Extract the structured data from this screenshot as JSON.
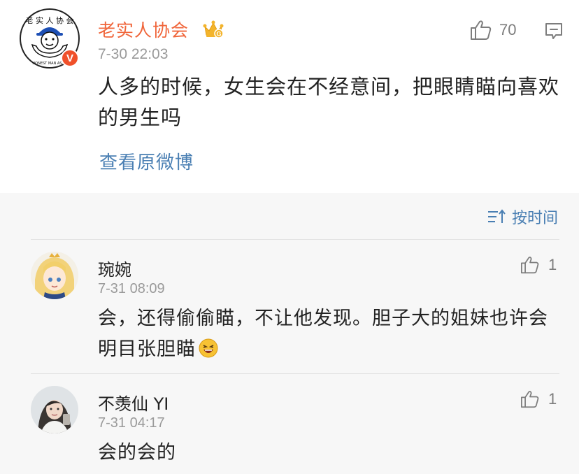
{
  "post": {
    "author": "老实人协会",
    "verified_badge": "V",
    "crown_badge_letter": "G",
    "time": "7-30 22:03",
    "like_count": "70",
    "text": "人多的时候，女生会在不经意间，把眼睛瞄向喜欢的男生吗",
    "view_original": "查看原微博",
    "avatar_text": {
      "top": "老实人协会",
      "bottom": "HONEST MAN ASSO"
    }
  },
  "comments_section": {
    "sort_label": "按时间",
    "comments": [
      {
        "author": "琬婉",
        "time": "7-31 08:09",
        "like_count": "1",
        "text": "会，还得偷偷瞄，不让他发现。胆子大的姐妹也许会明目张胆瞄"
      },
      {
        "author": "不羡仙 YI",
        "time": "7-31 04:17",
        "like_count": "1",
        "text": "会的会的"
      }
    ]
  },
  "colors": {
    "author_orange": "#f0663b",
    "link_blue": "#4a7fb3",
    "meta_gray": "#9a9a9a",
    "section_bg": "#f7f7f7"
  },
  "icons": [
    "crown-icon",
    "thumb-up-icon",
    "comment-icon",
    "sort-icon",
    "laugh-emoji-icon",
    "verified-icon"
  ]
}
